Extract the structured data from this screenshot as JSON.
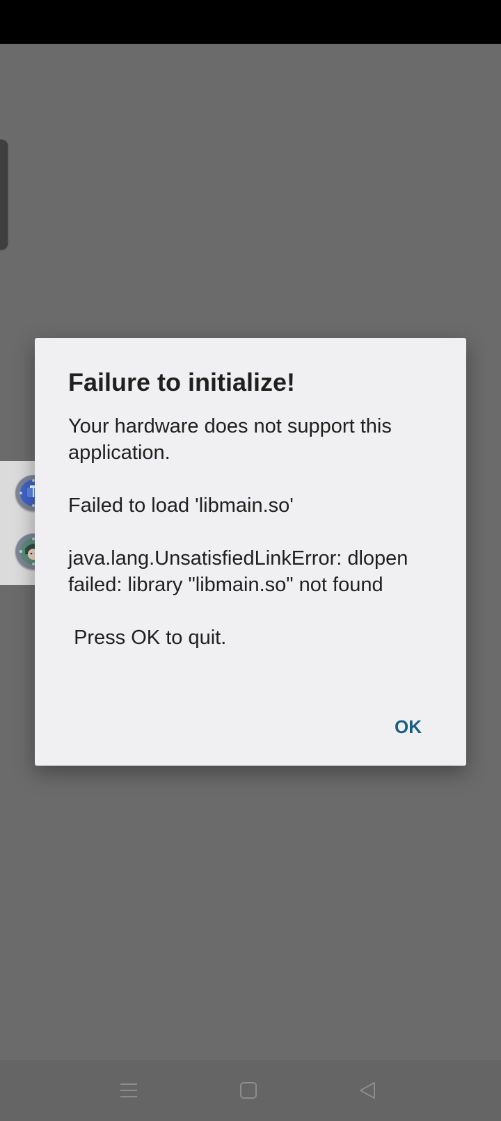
{
  "dialog": {
    "title": "Failure to initialize!",
    "message": "Your hardware does not support this application.\n\nFailed to load 'libmain.so'\n\njava.lang.UnsatisfiedLinkError: dlopen failed: library \"libmain.so\" not found\n\n Press OK to quit.",
    "ok_label": "OK"
  },
  "floating_dock": {
    "apps": [
      {
        "icon": "app-icon-blue-robot"
      },
      {
        "icon": "app-icon-avatar-character"
      }
    ]
  },
  "navigation": {
    "menu_icon": "menu-icon",
    "home_icon": "home-icon",
    "back_icon": "back-icon"
  },
  "colors": {
    "background_overlay": "#6b6b6b",
    "dialog_background": "#f0f0f2",
    "accent": "#1a5f82"
  }
}
